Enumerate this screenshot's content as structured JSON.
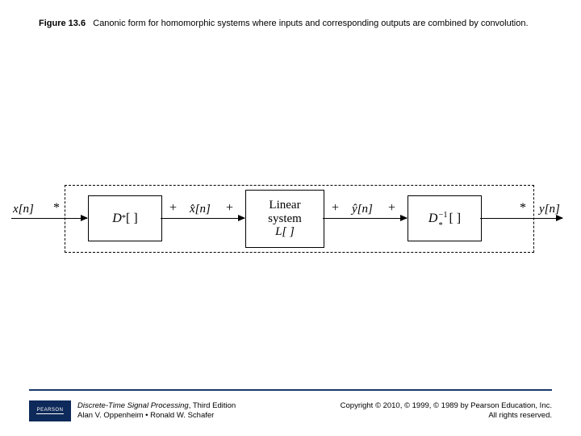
{
  "caption": {
    "label": "Figure 13.6",
    "text": "Canonic form for homomorphic systems where inputs and corresponding outputs are combined by convolution."
  },
  "diagram": {
    "input": "x[n]",
    "input_op": "*",
    "block1": "D",
    "block1_sub": "*",
    "block1_brackets": "[ ]",
    "sig1_pre": "+",
    "sig1": "x̂[n]",
    "sig1_post": "+",
    "block2_line1": "Linear",
    "block2_line2": "system",
    "block2_line3": "L[ ]",
    "sig2_pre": "+",
    "sig2": "ŷ[n]",
    "sig2_post": "+",
    "block3": "D",
    "block3_super": "−1",
    "block3_sub": "*",
    "block3_brackets": "[ ]",
    "output_op": "*",
    "output": "y[n]"
  },
  "footer": {
    "publisher": "PEARSON",
    "book_title": "Discrete-Time Signal Processing",
    "book_edition": ", Third Edition",
    "authors": "Alan V. Oppenheim • Ronald W. Schafer",
    "copyright": "Copyright © 2010, © 1999, © 1989 by Pearson Education, Inc.",
    "rights": "All rights reserved."
  }
}
